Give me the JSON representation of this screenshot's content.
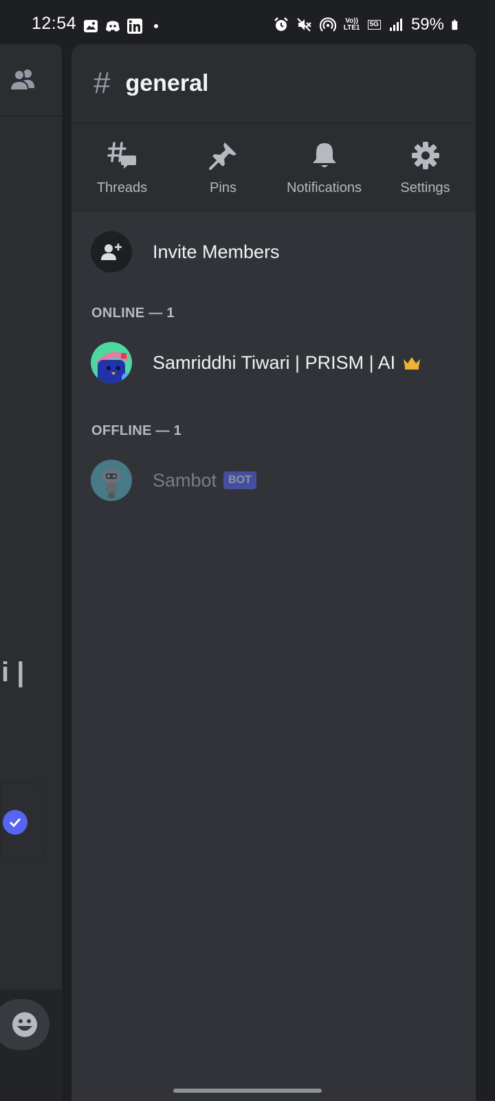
{
  "status_bar": {
    "time": "12:54",
    "volte_label": "Vo)) LTE1",
    "network_label": "5G",
    "battery": "59%"
  },
  "background": {
    "text_fragment": "i |"
  },
  "channel": {
    "hash": "#",
    "name": "general"
  },
  "actions": [
    {
      "label": "Threads",
      "icon": "threads-icon"
    },
    {
      "label": "Pins",
      "icon": "pin-icon"
    },
    {
      "label": "Notifications",
      "icon": "bell-icon"
    },
    {
      "label": "Settings",
      "icon": "gear-icon"
    }
  ],
  "invite": {
    "label": "Invite Members"
  },
  "online": {
    "header": "ONLINE — 1",
    "members": [
      {
        "name": "Samriddhi Tiwari | PRISM | AI",
        "role_icon": "crown-icon"
      }
    ]
  },
  "offline": {
    "header": "OFFLINE — 1",
    "members": [
      {
        "name": "Sambot",
        "tag": "BOT"
      }
    ]
  },
  "colors": {
    "background": "#1e1f22",
    "drawer": "#313338",
    "header": "#2b2d31",
    "accent": "#5865f2",
    "crown": "#f0b232"
  }
}
